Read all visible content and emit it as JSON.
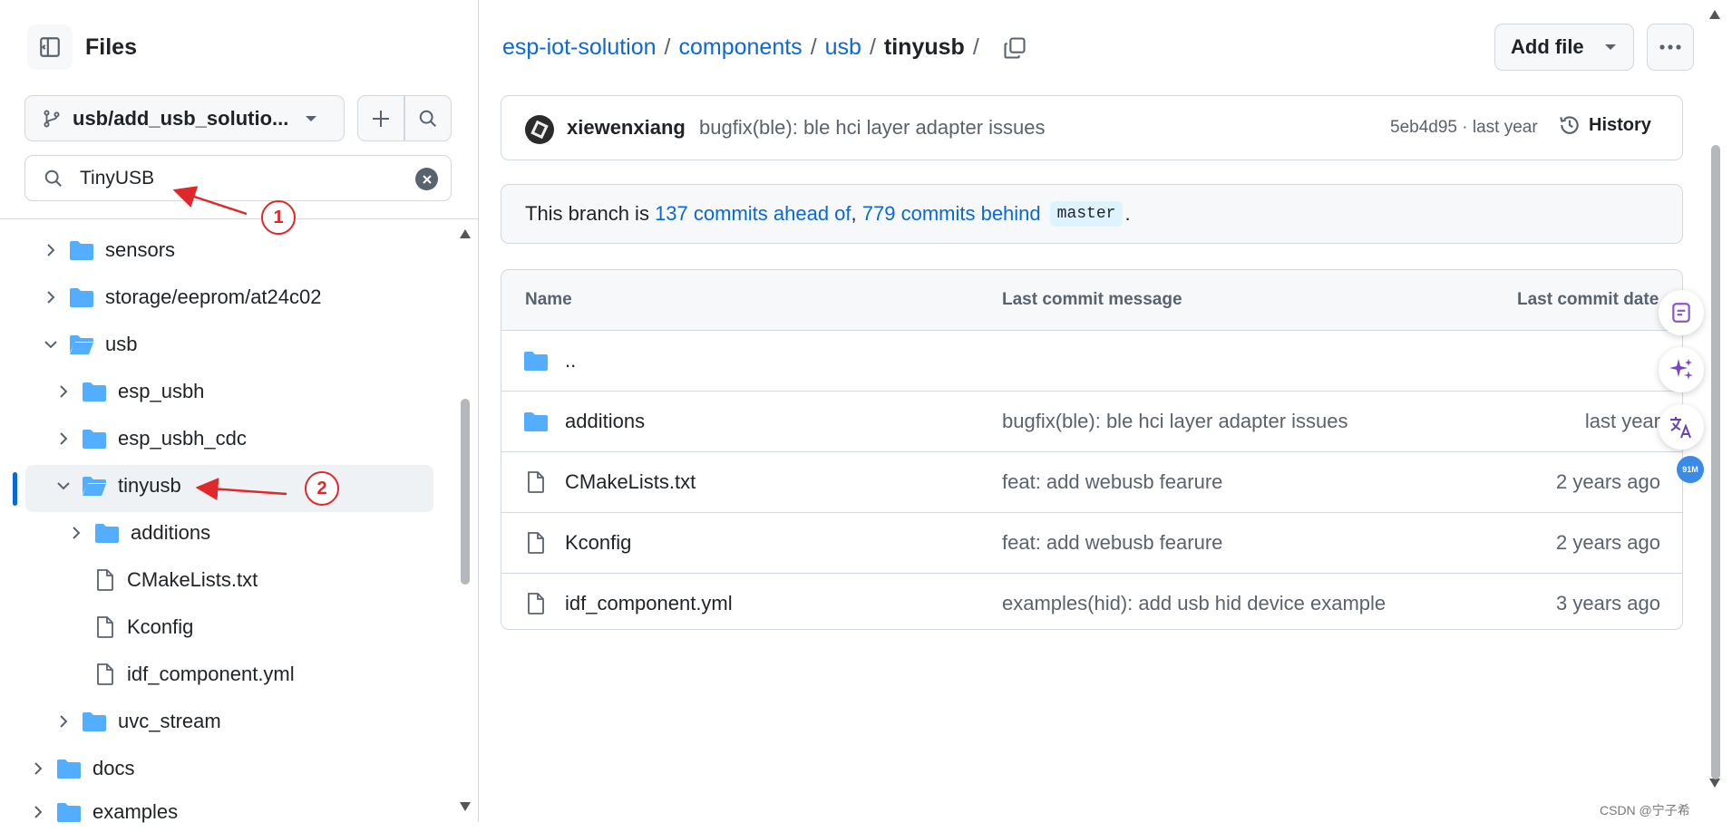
{
  "sidebar": {
    "title": "Files",
    "branch": "usb/add_usb_solutio...",
    "search_value": "TinyUSB",
    "tree": [
      {
        "label": "sensors",
        "type": "folder",
        "expanded": false
      },
      {
        "label": "storage/eeprom/at24c02",
        "type": "folder",
        "expanded": false
      },
      {
        "label": "usb",
        "type": "folder",
        "expanded": true
      },
      {
        "label": "esp_usbh",
        "type": "folder",
        "expanded": false
      },
      {
        "label": "esp_usbh_cdc",
        "type": "folder",
        "expanded": false
      },
      {
        "label": "tinyusb",
        "type": "folder",
        "expanded": true,
        "selected": true
      },
      {
        "label": "additions",
        "type": "folder",
        "expanded": false
      },
      {
        "label": "CMakeLists.txt",
        "type": "file"
      },
      {
        "label": "Kconfig",
        "type": "file"
      },
      {
        "label": "idf_component.yml",
        "type": "file"
      },
      {
        "label": "uvc_stream",
        "type": "folder",
        "expanded": false
      },
      {
        "label": "docs",
        "type": "folder",
        "expanded": false
      },
      {
        "label": "examples",
        "type": "folder",
        "expanded": false
      }
    ]
  },
  "annotations": {
    "one": "1",
    "two": "2"
  },
  "breadcrumb": {
    "repo": "esp-iot-solution",
    "p1": "components",
    "p2": "usb",
    "current": "tinyusb",
    "sep": "/"
  },
  "toolbar": {
    "add_file": "Add file"
  },
  "commit": {
    "author": "xiewenxiang",
    "message": "bugfix(ble): ble hci layer adapter issues",
    "meta": "5eb4d95 · last year",
    "history": "History"
  },
  "branch_info": {
    "prefix": "This branch is ",
    "ahead": "137 commits ahead of",
    "comma": ", ",
    "behind": "779 commits behind",
    "base": "master",
    "suffix": "."
  },
  "table": {
    "headers": {
      "name": "Name",
      "message": "Last commit message",
      "date": "Last commit date"
    },
    "parent": "..",
    "rows": [
      {
        "name": "additions",
        "type": "folder",
        "message": "bugfix(ble): ble hci layer adapter issues",
        "date": "last year"
      },
      {
        "name": "CMakeLists.txt",
        "type": "file",
        "message": "feat: add webusb fearure",
        "date": "2 years ago"
      },
      {
        "name": "Kconfig",
        "type": "file",
        "message": "feat: add webusb fearure",
        "date": "2 years ago"
      },
      {
        "name": "idf_component.yml",
        "type": "file",
        "message": "examples(hid): add usb hid device example",
        "date": "3 years ago"
      }
    ]
  },
  "badge": "91M",
  "watermark": "CSDN @宁子希",
  "colors": {
    "link": "#0969da",
    "folder": "#54aeff",
    "annotation": "#e0282a"
  }
}
